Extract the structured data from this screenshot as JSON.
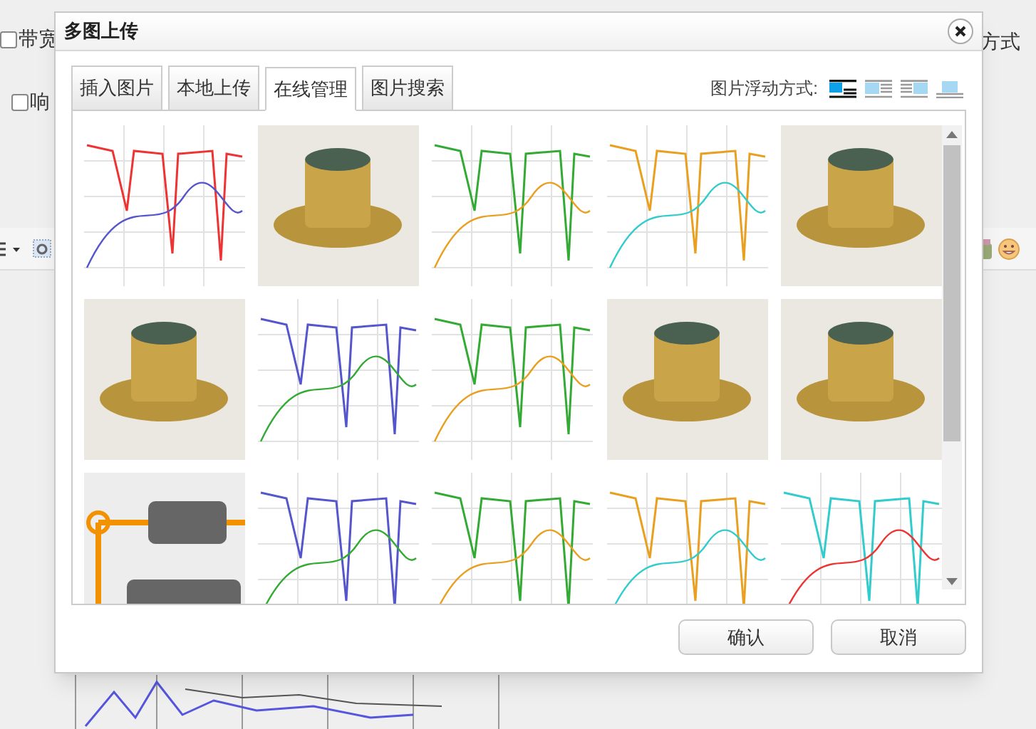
{
  "background": {
    "checkboxes": [
      {
        "label": "带宽",
        "checked": false
      },
      {
        "label": "响",
        "checked": false
      }
    ],
    "right_label": "方式"
  },
  "dialog": {
    "title": "多图上传",
    "tabs": [
      {
        "label": "插入图片",
        "selected": false
      },
      {
        "label": "本地上传",
        "selected": false
      },
      {
        "label": "在线管理",
        "selected": true
      },
      {
        "label": "图片搜索",
        "selected": false
      }
    ],
    "float_label": "图片浮动方式:",
    "float_modes": [
      {
        "kind": "none",
        "selected": true
      },
      {
        "kind": "left",
        "selected": false
      },
      {
        "kind": "right",
        "selected": false
      },
      {
        "kind": "center",
        "selected": false
      }
    ],
    "images": [
      {
        "kind": "chart"
      },
      {
        "kind": "photo"
      },
      {
        "kind": "chart"
      },
      {
        "kind": "chart"
      },
      {
        "kind": "photo"
      },
      {
        "kind": "photo"
      },
      {
        "kind": "chart"
      },
      {
        "kind": "chart"
      },
      {
        "kind": "photo"
      },
      {
        "kind": "photo"
      },
      {
        "kind": "diagram"
      },
      {
        "kind": "chart"
      },
      {
        "kind": "chart"
      },
      {
        "kind": "chart"
      },
      {
        "kind": "chart"
      }
    ],
    "buttons": [
      "确认",
      "取消"
    ]
  }
}
